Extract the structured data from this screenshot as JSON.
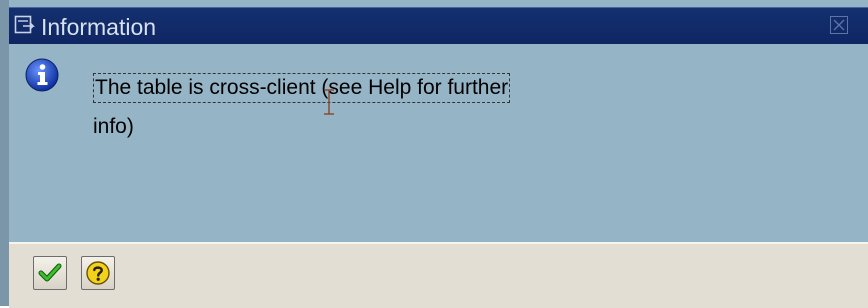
{
  "window": {
    "title": "Information",
    "title_icon": "dialog-window-icon",
    "close_icon": "close-icon"
  },
  "message": {
    "icon": "info-icon",
    "line1": "The table is cross-client (see Help for further",
    "line2": "info)"
  },
  "buttons": [
    {
      "name": "continue-button",
      "icon": "checkmark-icon"
    },
    {
      "name": "help-button",
      "icon": "help-icon"
    }
  ],
  "colors": {
    "title_bar": "#14306f",
    "content_bg": "#95b5c7",
    "footer_bg": "#e3ded4",
    "info_icon": "#1d4ec7",
    "check_green": "#1f9a1f",
    "help_yellow": "#f2d21b"
  }
}
